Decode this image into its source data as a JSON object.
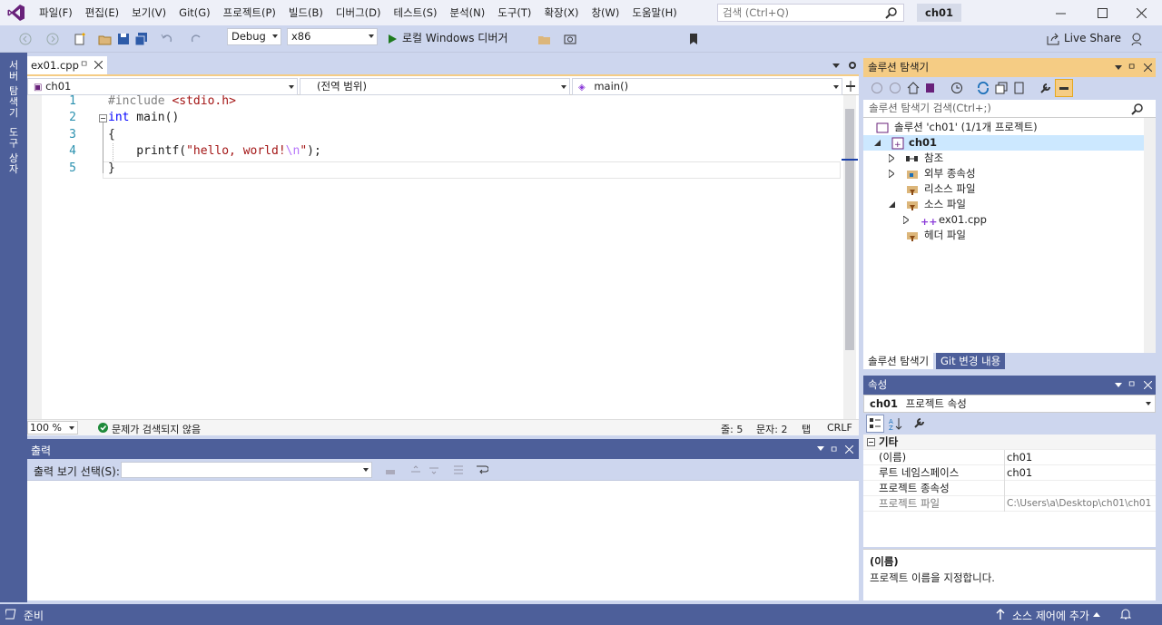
{
  "menu": [
    "파일(F)",
    "편집(E)",
    "보기(V)",
    "Git(G)",
    "프로젝트(P)",
    "빌드(B)",
    "디버그(D)",
    "테스트(S)",
    "분석(N)",
    "도구(T)",
    "확장(X)",
    "창(W)",
    "도움말(H)"
  ],
  "search": {
    "placeholder": "검색 (Ctrl+Q)"
  },
  "project_badge": "ch01",
  "toolbar": {
    "config": "Debug",
    "platform": "x86",
    "run_label": "로컬 Windows 디버거",
    "liveshare": "Live Share"
  },
  "left_tabs": [
    "서버 탐색기",
    "도구 상자"
  ],
  "editor": {
    "tab": "ex01.cpp",
    "tab_pin": "ㅁ",
    "nav": {
      "scope": "ch01",
      "context": "(전역 범위)",
      "member": "main()"
    },
    "line_numbers": [
      "1",
      "2",
      "3",
      "4",
      "5"
    ],
    "code": {
      "l1_pp": "#include ",
      "l1_hdr": "<stdio.h>",
      "l2_kw": "int",
      "l2_rest": " main()",
      "l3": "{",
      "l4_fn": "    printf(",
      "l4_str": "\"hello, world!",
      "l4_esc": "\\n",
      "l4_q": "\"",
      "l4_end": ");",
      "l5": "}"
    },
    "status": {
      "zoom": "100 %",
      "issues": "문제가 검색되지 않음",
      "line": "줄: 5",
      "col": "문자: 2",
      "tab": "탭",
      "eol": "CRLF"
    }
  },
  "output": {
    "title": "출력",
    "select_label": "출력 보기 선택(S):"
  },
  "solution_explorer": {
    "title": "솔루션 탐색기",
    "search_placeholder": "솔루션 탐색기 검색(Ctrl+;)",
    "tree": [
      {
        "label": "솔루션 'ch01' (1/1개 프로젝트)"
      },
      {
        "label": "ch01"
      },
      {
        "label": "참조"
      },
      {
        "label": "외부 종속성"
      },
      {
        "label": "리소스 파일"
      },
      {
        "label": "소스 파일"
      },
      {
        "label": "ex01.cpp"
      },
      {
        "label": "헤더 파일"
      }
    ],
    "tabs": [
      "솔루션 탐색기",
      "Git 변경 내용"
    ]
  },
  "properties": {
    "title": "속성",
    "object": "ch01",
    "object_type": "프로젝트 속성",
    "category": "기타",
    "rows": [
      {
        "name": "(이름)",
        "value": "ch01"
      },
      {
        "name": "루트 네임스페이스",
        "value": "ch01"
      },
      {
        "name": "프로젝트 종속성",
        "value": ""
      },
      {
        "name": "프로젝트 파일",
        "value": "C:\\Users\\a\\Desktop\\ch01\\ch01"
      }
    ],
    "desc_title": "(이름)",
    "desc_text": "프로젝트 이름을 지정합니다."
  },
  "statusbar": {
    "ready": "준비",
    "source_control": "소스 제어에 추가"
  },
  "colors": {
    "accent": "#4d5f9a",
    "toolbar": "#cdd6ee",
    "active_tab": "#f5cc84",
    "vs_purple": "#68217a"
  }
}
